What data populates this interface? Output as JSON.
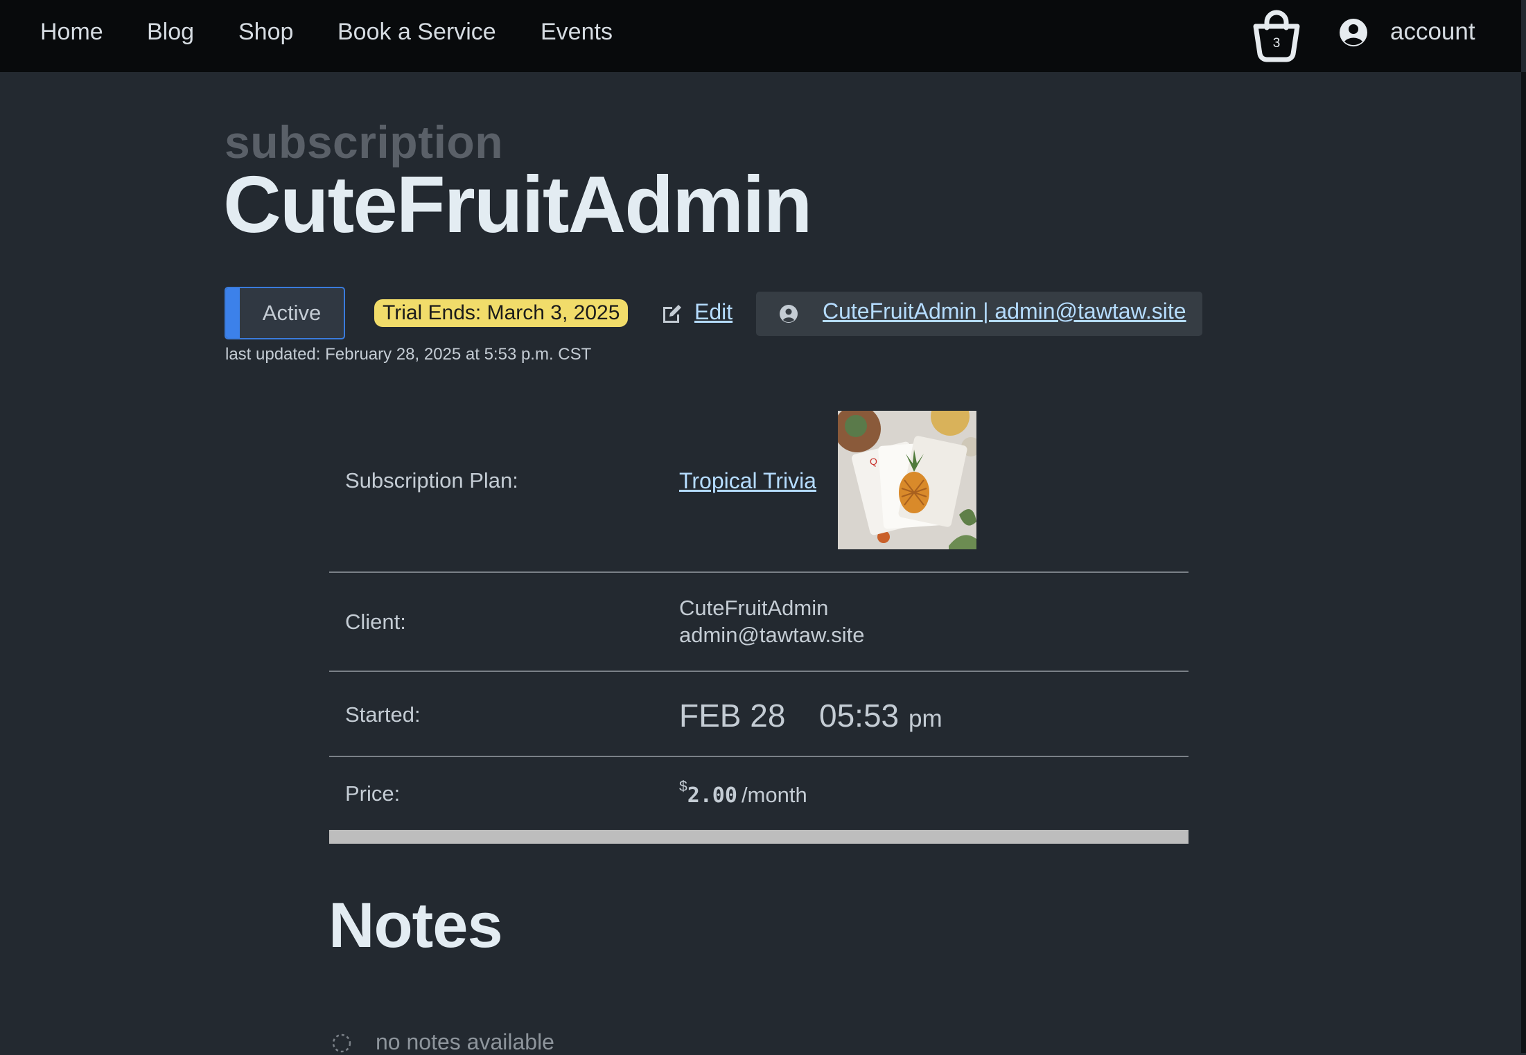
{
  "nav": {
    "links": [
      "Home",
      "Blog",
      "Shop",
      "Book a Service",
      "Events"
    ],
    "cart_count": "3",
    "account_label": "account"
  },
  "header": {
    "kicker": "subscription",
    "title": "CuteFruitAdmin"
  },
  "status": {
    "label": "Active",
    "trial": "Trial Ends: March 3, 2025",
    "edit_label": "Edit",
    "user_link": "CuteFruitAdmin | admin@tawtaw.site",
    "last_updated": "last updated: February 28, 2025 at 5:53 p.m. CST"
  },
  "details": {
    "plan_label": "Subscription Plan:",
    "plan_name": "Tropical Trivia",
    "client_label": "Client:",
    "client_name": "CuteFruitAdmin",
    "client_email": "admin@tawtaw.site",
    "started_label": "Started:",
    "started_date": "FEB 28",
    "started_time": "05:53",
    "started_ampm": "pm",
    "price_label": "Price:",
    "price_currency": "$",
    "price_amount": "2.00",
    "price_period": "/month"
  },
  "notes": {
    "title": "Notes",
    "empty": "no notes available"
  },
  "colors": {
    "background": "#232930",
    "nav_bg": "#080a0c",
    "accent_blue": "#3c81ea",
    "link": "#b5dcff",
    "trial_badge": "#f1dc6a"
  },
  "icons": [
    "shopping-bag-icon",
    "account-icon",
    "edit-icon",
    "user-circle-icon",
    "spinner-icon"
  ]
}
